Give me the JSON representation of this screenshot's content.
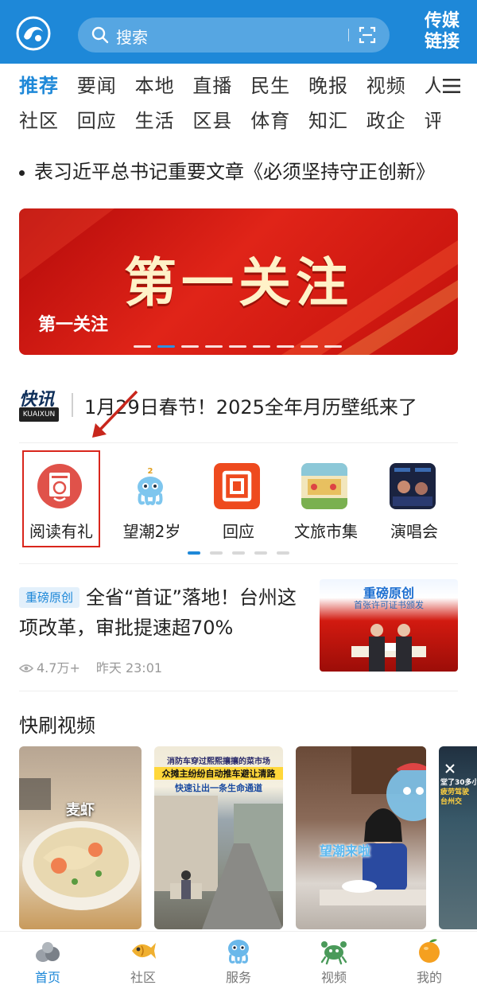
{
  "header": {
    "search_placeholder": "搜索",
    "brand_line1": "传媒",
    "brand_line2": "链接"
  },
  "nav": {
    "row1": [
      "推荐",
      "要闻",
      "本地",
      "直播",
      "民生",
      "晚报",
      "视频",
      "人"
    ],
    "row2": [
      "社区",
      "回应",
      "生活",
      "区县",
      "体育",
      "知汇",
      "政企",
      "评"
    ],
    "active": "推荐"
  },
  "headline": "表习近平总书记重要文章《必须坚持守正创新》",
  "banner": {
    "big_text": "第一关注",
    "caption": "第一关注",
    "dot_count": 9,
    "active_dot": 1
  },
  "kuaixun": {
    "logo_text": "快讯",
    "logo_sub": "KUAIXUN",
    "text": "1月29日春节！2025全年月历壁纸来了"
  },
  "shortcuts": [
    {
      "label": "阅读有礼",
      "icon": "reading-gift-icon"
    },
    {
      "label": "望潮2岁",
      "icon": "mascot-icon"
    },
    {
      "label": "回应",
      "icon": "reply-icon"
    },
    {
      "label": "文旅市集",
      "icon": "market-icon"
    },
    {
      "label": "演唱会",
      "icon": "concert-icon"
    }
  ],
  "shortcut_pager": {
    "count": 5,
    "active": 0
  },
  "news": {
    "tag": "重磅原创",
    "title": "全省“首证”落地！台州这项改革，审批提速超70%",
    "views": "4.7万+",
    "time": "昨天  23:01",
    "thumb_title": "重磅原创",
    "thumb_sub": "首张许可证书颁发"
  },
  "videos": {
    "section_title": "快刷视频",
    "items": [
      {
        "caption": "麦虾"
      },
      {
        "line1": "消防车穿过熙熙攘攘的菜市场",
        "line2": "众摊主纷纷自动推车避让清路",
        "line3": "快速让出一条生命通道"
      },
      {
        "overlay": "望潮来啦"
      },
      {
        "line1": "堂了30多小",
        "line2": "疲劳驾驶",
        "line3": "台州交"
      }
    ]
  },
  "tabbar": [
    {
      "label": "首页",
      "icon": "home-icon",
      "active": true
    },
    {
      "label": "社区",
      "icon": "community-fish-icon",
      "active": false
    },
    {
      "label": "服务",
      "icon": "service-octopus-icon",
      "active": false
    },
    {
      "label": "视频",
      "icon": "video-crab-icon",
      "active": false
    },
    {
      "label": "我的",
      "icon": "mine-orange-icon",
      "active": false
    }
  ],
  "colors": {
    "brand_blue": "#1e88d8",
    "banner_red": "#d21a10",
    "annotation_red": "#d9261c"
  }
}
